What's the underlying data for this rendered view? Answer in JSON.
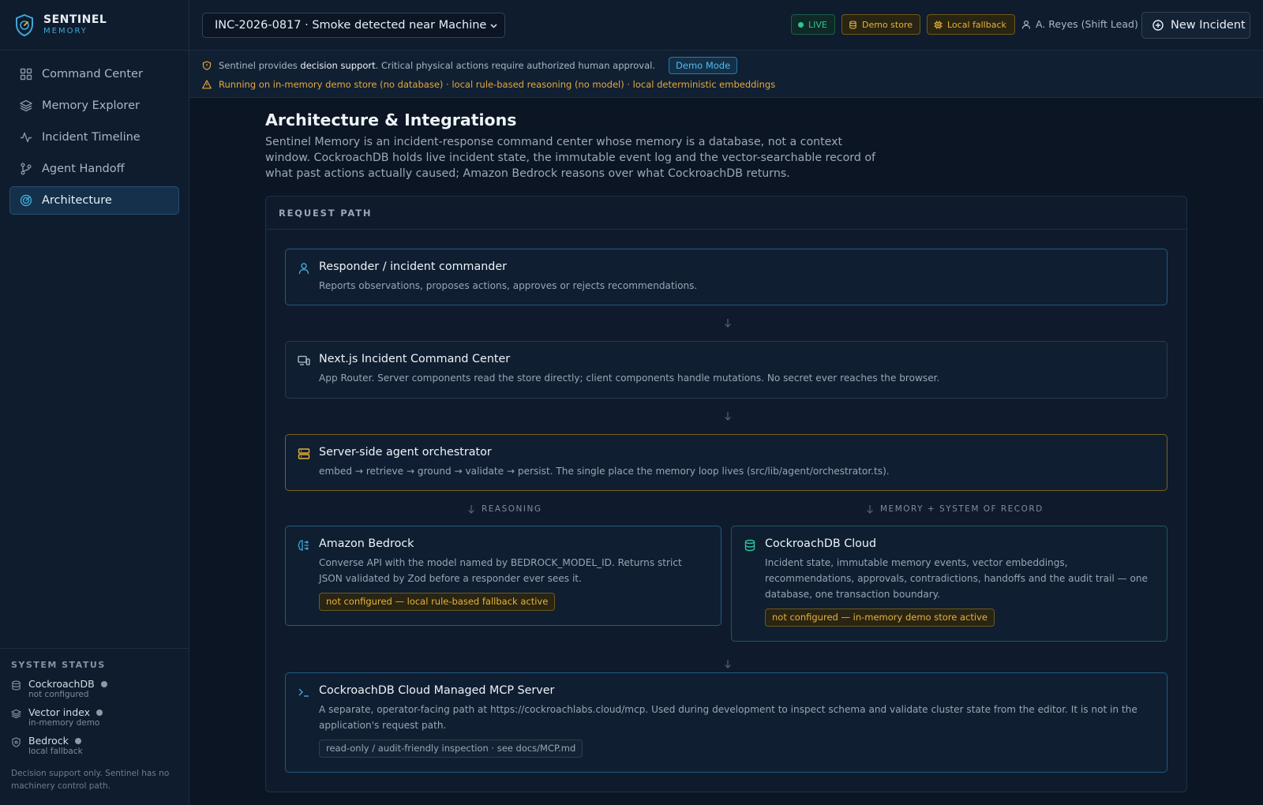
{
  "brand": {
    "name": "SENTINEL",
    "sub": "MEMORY"
  },
  "nav": [
    {
      "label": "Command Center",
      "icon": "grid-icon"
    },
    {
      "label": "Memory Explorer",
      "icon": "layers-icon"
    },
    {
      "label": "Incident Timeline",
      "icon": "activity-icon"
    },
    {
      "label": "Agent Handoff",
      "icon": "git-branch-icon"
    },
    {
      "label": "Architecture",
      "icon": "radar-icon",
      "active": true
    }
  ],
  "system_status": {
    "title": "SYSTEM STATUS",
    "items": [
      {
        "name": "CockroachDB",
        "status": "not configured",
        "icon": "database-icon"
      },
      {
        "name": "Vector index",
        "status": "in-memory demo",
        "icon": "layers-icon"
      },
      {
        "name": "Bedrock",
        "status": "local fallback",
        "icon": "shield-icon"
      }
    ],
    "note": "Decision support only. Sentinel has no machinery control path."
  },
  "topbar": {
    "incident": "INC-2026-0817 · Smoke detected near Machine",
    "live": "LIVE",
    "store": "Demo store",
    "fallback": "Local fallback",
    "user": "A. Reyes (Shift Lead)",
    "new_incident": "New Incident"
  },
  "notice": {
    "prefix": "Sentinel provides",
    "emphasis": "decision support",
    "suffix": ". Critical physical actions require authorized human approval.",
    "badge": "Demo Mode",
    "warning": "Running on in-memory demo store (no database) · local rule-based reasoning (no model) · local deterministic embeddings"
  },
  "page": {
    "title": "Architecture & Integrations",
    "description": "Sentinel Memory is an incident-response command center whose memory is a database, not a context window. CockroachDB holds live incident state, the immutable event log and the vector-searchable record of what past actions actually caused; Amazon Bedrock reasons over what CockroachDB returns."
  },
  "request_path": {
    "title": "REQUEST PATH",
    "responder": {
      "title": "Responder / incident commander",
      "desc": "Reports observations, proposes actions, approves or rejects recommendations."
    },
    "nextjs": {
      "title": "Next.js Incident Command Center",
      "desc": "App Router. Server components read the store directly; client components handle mutations. No secret ever reaches the browser."
    },
    "orchestrator": {
      "title": "Server-side agent orchestrator",
      "desc": "embed → retrieve → ground → validate → persist. The single place the memory loop lives (src/lib/agent/orchestrator.ts)."
    },
    "lane_reasoning": "REASONING",
    "lane_memory": "MEMORY + SYSTEM OF RECORD",
    "bedrock": {
      "title": "Amazon Bedrock",
      "desc": "Converse API with the model named by BEDROCK_MODEL_ID. Returns strict JSON validated by Zod before a responder ever sees it.",
      "tag": "not configured — local rule-based fallback active"
    },
    "cockroach": {
      "title": "CockroachDB Cloud",
      "desc": "Incident state, immutable memory events, vector embeddings, recommendations, approvals, contradictions, handoffs and the audit trail — one database, one transaction boundary.",
      "tag": "not configured — in-memory demo store active"
    },
    "mcp": {
      "title": "CockroachDB Cloud Managed MCP Server",
      "desc": "A separate, operator-facing path at https://cockroachlabs.cloud/mcp. Used during development to inspect schema and validate cluster state from the editor. It is not in the application's request path.",
      "tag": "read-only / audit-friendly inspection · see docs/MCP.md"
    }
  },
  "colors": {
    "accent": "#3fa7d6",
    "amber": "#e5b33b",
    "green": "#2ec39a",
    "background": "#0b1524"
  }
}
